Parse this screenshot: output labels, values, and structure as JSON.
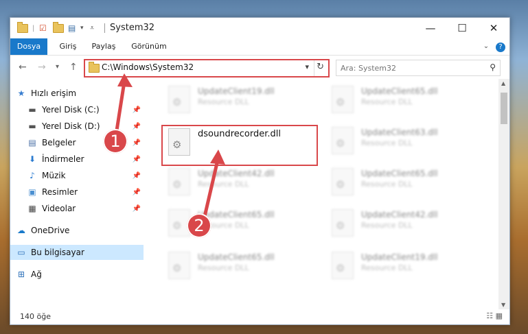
{
  "window": {
    "title": "System32",
    "controls": {
      "minimize": "—",
      "maximize": "☐",
      "close": "✕"
    }
  },
  "ribbon": {
    "tabs": [
      "Dosya",
      "Giriş",
      "Paylaş",
      "Görünüm"
    ],
    "expand_icon": "chevron-down-icon",
    "help_icon": "?"
  },
  "nav": {
    "back": "←",
    "forward": "→",
    "recent": "▾",
    "up": "↑"
  },
  "address": {
    "path": "C:\\Windows\\System32",
    "dropdown": "▾",
    "refresh": "↻"
  },
  "search": {
    "placeholder": "Ara: System32",
    "icon": "⚲"
  },
  "sidebar": {
    "items": [
      {
        "label": "Hızlı erişim",
        "icon": "star-icon",
        "glyph": "★"
      },
      {
        "label": "Yerel Disk (C:)",
        "icon": "drive-icon",
        "glyph": "▬",
        "pinned": true
      },
      {
        "label": "Yerel Disk (D:)",
        "icon": "drive-icon",
        "glyph": "▬",
        "pinned": true
      },
      {
        "label": "Belgeler",
        "icon": "documents-icon",
        "glyph": "▤",
        "pinned": true
      },
      {
        "label": "İndirmeler",
        "icon": "downloads-icon",
        "glyph": "⬇",
        "pinned": true
      },
      {
        "label": "Müzik",
        "icon": "music-icon",
        "glyph": "♪",
        "pinned": true
      },
      {
        "label": "Resimler",
        "icon": "pictures-icon",
        "glyph": "▣",
        "pinned": true
      },
      {
        "label": "Videolar",
        "icon": "videos-icon",
        "glyph": "▦",
        "pinned": true
      },
      {
        "label": "OneDrive",
        "icon": "cloud-icon",
        "glyph": "☁"
      },
      {
        "label": "Bu bilgisayar",
        "icon": "computer-icon",
        "glyph": "▭",
        "selected": true
      },
      {
        "label": "Ağ",
        "icon": "network-icon",
        "glyph": "⊞"
      }
    ],
    "pin_glyph": "📌"
  },
  "files": {
    "highlighted": {
      "name": "dsoundrecorder.dll"
    },
    "items": [
      {
        "name": "UpdateClient19.dll",
        "type": "Resource DLL"
      },
      {
        "name": "UpdateClient65.dll",
        "type": "Resource DLL"
      },
      {
        "name": "UpdateClient63.dll",
        "type": "Resource DLL"
      },
      {
        "name": "UpdateClient42.dll",
        "type": "Resource DLL"
      },
      {
        "name": "UpdateClient65.dll",
        "type": "Resource DLL"
      },
      {
        "name": "UpdateClient65.dll",
        "type": "Resource DLL"
      },
      {
        "name": "UpdateClient42.dll",
        "type": "Resource DLL"
      },
      {
        "name": "UpdateClient65.dll",
        "type": "Resource DLL"
      },
      {
        "name": "UpdateClient19.dll",
        "type": "Resource DLL"
      }
    ]
  },
  "status": {
    "item_count": "140 öğe"
  },
  "annotations": {
    "step1": "1",
    "step2": "2",
    "accent": "#d9474a"
  }
}
